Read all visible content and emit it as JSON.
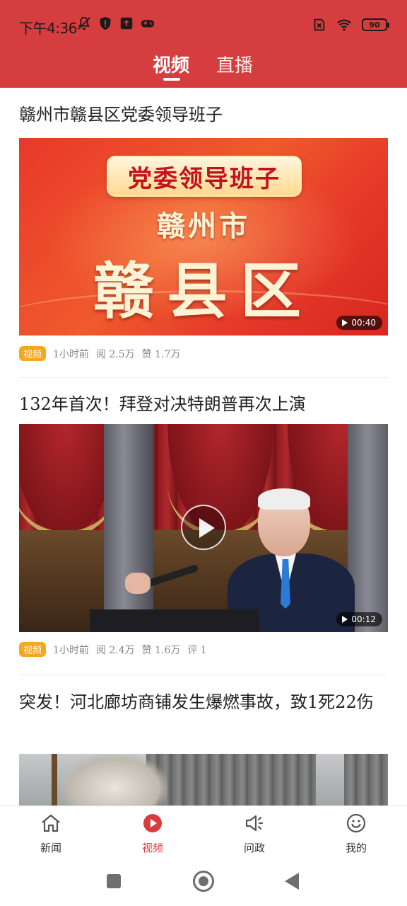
{
  "status_bar": {
    "time": "下午4:36",
    "battery": "90",
    "left_icons": [
      "mute-bell-icon",
      "shield-icon",
      "upload-box-icon",
      "gamepad-icon"
    ],
    "right_icons": [
      "sim-x-icon",
      "wifi-icon",
      "battery-icon"
    ]
  },
  "top_tabs": [
    {
      "label": "视频",
      "active": true
    },
    {
      "label": "直播",
      "active": false
    }
  ],
  "feed": [
    {
      "title": "赣州市赣县区党委领导班子",
      "thumb_text": {
        "banner": "党委领导班子",
        "city": "赣州市",
        "county": "赣县区"
      },
      "duration": "00:40",
      "badge": "视频",
      "time": "1小时前",
      "views": "阅 2.5万",
      "likes": "赞 1.7万"
    },
    {
      "title": "132年首次！拜登对决特朗普再次上演",
      "duration": "00:12",
      "badge": "视频",
      "time": "1小时前",
      "views": "阅 2.4万",
      "likes": "赞 1.6万",
      "comments": "评 1"
    },
    {
      "title": "突发！河北廊坊商铺发生爆燃事故，致1死22伤"
    }
  ],
  "bottom_nav": [
    {
      "label": "新闻",
      "icon": "home-icon",
      "active": false
    },
    {
      "label": "视频",
      "icon": "play-circle-icon",
      "active": true
    },
    {
      "label": "问政",
      "icon": "megaphone-icon",
      "active": false
    },
    {
      "label": "我的",
      "icon": "smiley-icon",
      "active": false
    }
  ],
  "colors": {
    "brand_red": "#d63d3f",
    "badge_orange": "#f5a623",
    "text_dark": "#222222",
    "text_meta": "#888888"
  }
}
